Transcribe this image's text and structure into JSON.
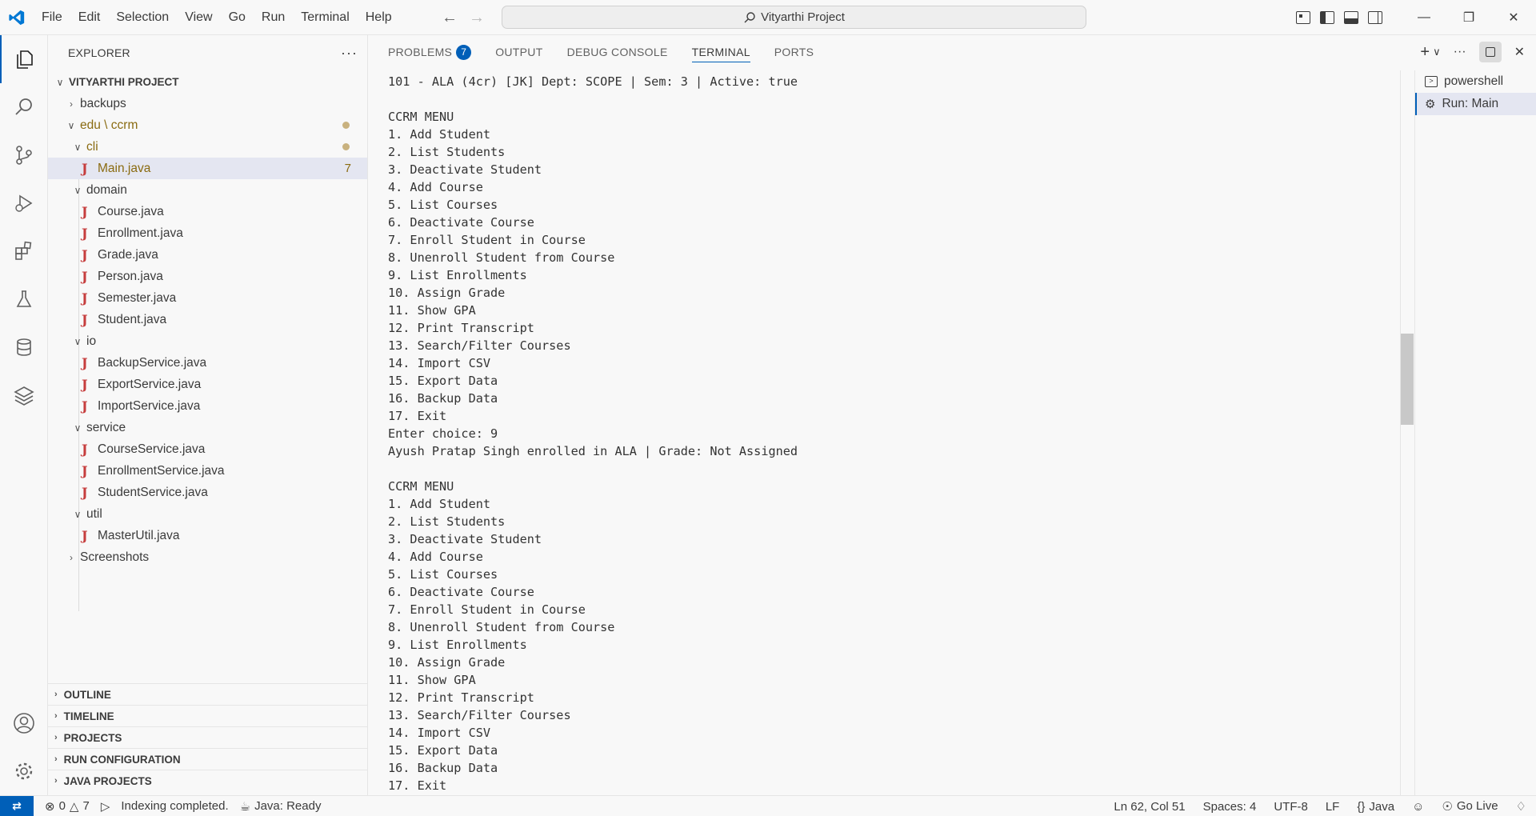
{
  "menu": [
    "File",
    "Edit",
    "Selection",
    "View",
    "Go",
    "Run",
    "Terminal",
    "Help"
  ],
  "command_center": "Vityarthi Project",
  "explorer": {
    "title": "EXPLORER",
    "project": "VITYARTHI PROJECT",
    "rows": [
      {
        "label": "backups",
        "badge": ""
      },
      {
        "label": "edu \\ ccrm",
        "badge": ""
      },
      {
        "label": "cli",
        "badge": ""
      },
      {
        "label": "Main.java",
        "badge": "7"
      },
      {
        "label": "domain",
        "badge": ""
      },
      {
        "label": "Course.java",
        "badge": ""
      },
      {
        "label": "Enrollment.java",
        "badge": ""
      },
      {
        "label": "Grade.java",
        "badge": ""
      },
      {
        "label": "Person.java",
        "badge": ""
      },
      {
        "label": "Semester.java",
        "badge": ""
      },
      {
        "label": "Student.java",
        "badge": ""
      },
      {
        "label": "io",
        "badge": ""
      },
      {
        "label": "BackupService.java",
        "badge": ""
      },
      {
        "label": "ExportService.java",
        "badge": ""
      },
      {
        "label": "ImportService.java",
        "badge": ""
      },
      {
        "label": "service",
        "badge": ""
      },
      {
        "label": "CourseService.java",
        "badge": ""
      },
      {
        "label": "EnrollmentService.java",
        "badge": ""
      },
      {
        "label": "StudentService.java",
        "badge": ""
      },
      {
        "label": "util",
        "badge": ""
      },
      {
        "label": "MasterUtil.java",
        "badge": ""
      },
      {
        "label": "Screenshots",
        "badge": ""
      }
    ],
    "sections": [
      "OUTLINE",
      "TIMELINE",
      "PROJECTS",
      "RUN CONFIGURATION",
      "JAVA PROJECTS"
    ]
  },
  "panel": {
    "tabs": [
      "PROBLEMS",
      "OUTPUT",
      "DEBUG CONSOLE",
      "TERMINAL",
      "PORTS"
    ],
    "problems_count": "7",
    "terminals": [
      "powershell",
      "Run: Main"
    ]
  },
  "terminal_lines": [
    "101 - ALA (4cr) [JK] Dept: SCOPE | Sem: 3 | Active: true",
    "",
    "CCRM MENU",
    "1. Add Student",
    "2. List Students",
    "3. Deactivate Student",
    "4. Add Course",
    "5. List Courses",
    "6. Deactivate Course",
    "7. Enroll Student in Course",
    "8. Unenroll Student from Course",
    "9. List Enrollments",
    "10. Assign Grade",
    "11. Show GPA",
    "12. Print Transcript",
    "13. Search/Filter Courses",
    "14. Import CSV",
    "15. Export Data",
    "16. Backup Data",
    "17. Exit",
    "Enter choice: 9",
    "Ayush Pratap Singh enrolled in ALA | Grade: Not Assigned",
    "",
    "CCRM MENU",
    "1. Add Student",
    "2. List Students",
    "3. Deactivate Student",
    "4. Add Course",
    "5. List Courses",
    "6. Deactivate Course",
    "7. Enroll Student in Course",
    "8. Unenroll Student from Course",
    "9. List Enrollments",
    "10. Assign Grade",
    "11. Show GPA",
    "12. Print Transcript",
    "13. Search/Filter Courses",
    "14. Import CSV",
    "15. Export Data",
    "16. Backup Data",
    "17. Exit"
  ],
  "status": {
    "errors": "0",
    "warnings": "7",
    "indexing": "Indexing completed.",
    "java_status": "Java: Ready",
    "position": "Ln 62, Col 51",
    "spaces": "Spaces: 4",
    "encoding": "UTF-8",
    "eol": "LF",
    "language": "Java",
    "live": "Go Live"
  },
  "colors": {
    "accent": "#005fb8",
    "java_icon": "#c63d3d",
    "modified": "#8a6b11"
  }
}
